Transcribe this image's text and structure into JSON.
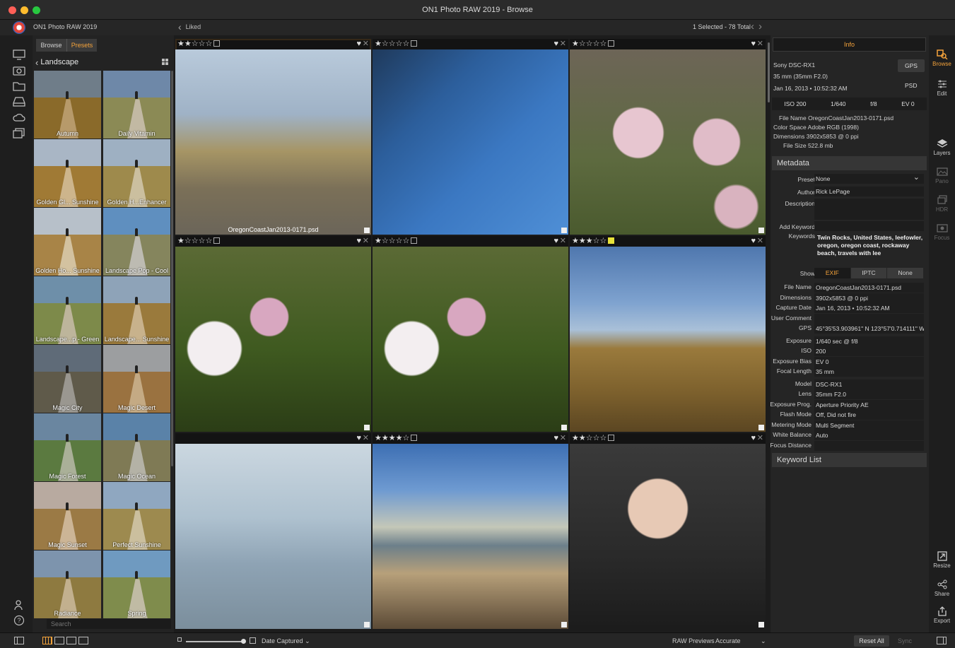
{
  "window": {
    "title": "ON1 Photo RAW 2019 - Browse"
  },
  "header": {
    "app_name": "ON1 Photo RAW 2019",
    "back_label": "Liked",
    "selection_status": "1 Selected - 78 Total"
  },
  "left_rail": {
    "icons": [
      "monitor-icon",
      "camera-icon",
      "folder-icon",
      "drive-icon",
      "cloud-icon",
      "albums-icon",
      "people-icon",
      "help-icon"
    ]
  },
  "preset_panel": {
    "tabs": [
      "Browse",
      "Presets"
    ],
    "active_tab": "Presets",
    "category": "Landscape",
    "search_placeholder": "Search",
    "presets": [
      {
        "label": "Autumn",
        "sky": "#6f7d89",
        "grass": "#8a6a2a",
        "path": "#b79a6a"
      },
      {
        "label": "Daily Vitamin",
        "sky": "#6e88a8",
        "grass": "#8b8a55",
        "path": "#c2b9a3"
      },
      {
        "label": "Golden Gl... Sunshine",
        "sky": "#a9b6c5",
        "grass": "#a07a35",
        "path": "#cdb58c"
      },
      {
        "label": "Golden H...Enhancer",
        "sky": "#9eb0c2",
        "grass": "#9e8a4c",
        "path": "#cbbf9f"
      },
      {
        "label": "Golden Ho... Sunshine",
        "sky": "#b7c0c9",
        "grass": "#a88447",
        "path": "#d3c2a0"
      },
      {
        "label": "Landscape Pop - Cool",
        "sky": "#5f8fbf",
        "grass": "#85855d",
        "path": "#bdbbb2"
      },
      {
        "label": "Landscape...p - Green",
        "sky": "#6e8fa9",
        "grass": "#7d8a4a",
        "path": "#bdb59b"
      },
      {
        "label": "Landscape... Sunshine",
        "sky": "#8ea3b8",
        "grass": "#9a7a3c",
        "path": "#c8b28c"
      },
      {
        "label": "Magic City",
        "sky": "#5f6b78",
        "grass": "#5f5a4a",
        "path": "#9a9790"
      },
      {
        "label": "Magic Desert",
        "sky": "#9c9ea0",
        "grass": "#9a7240",
        "path": "#c4aa84"
      },
      {
        "label": "Magic Forest",
        "sky": "#6a86a0",
        "grass": "#5b7a40",
        "path": "#aab098"
      },
      {
        "label": "Magic Ocean",
        "sky": "#5a82a8",
        "grass": "#7f7a55",
        "path": "#b4b2a6"
      },
      {
        "label": "Magic Sunset",
        "sky": "#b8aaa0",
        "grass": "#9b7a45",
        "path": "#ccb596"
      },
      {
        "label": "Perfect Sunshine",
        "sky": "#8fa7c0",
        "grass": "#9d8a4f",
        "path": "#cbbf9e"
      },
      {
        "label": "Radiance",
        "sky": "#7d94ad",
        "grass": "#8e7a40",
        "path": "#c2b08e"
      },
      {
        "label": "Spring",
        "sky": "#6f9ac0",
        "grass": "#7f8c4c",
        "path": "#c0bba4"
      }
    ]
  },
  "photos": [
    {
      "rating": 2,
      "flag": "none",
      "liked": true,
      "filename": "OregonCoastJan2013-0171.psd",
      "selected": true,
      "bg": "linear-gradient(180deg,#b9cadb 0%,#9fb2c6 35%,#a69565 55%,#7b7058 75%,#6b6559 100%)"
    },
    {
      "rating": 1,
      "flag": "none",
      "liked": true,
      "filename": "",
      "selected": false,
      "bg": "linear-gradient(135deg,#1f3a5c 0%,#2c5e9b 30%,#3b78c2 60%,#4f8fd6 100%)"
    },
    {
      "rating": 1,
      "flag": "none",
      "liked": true,
      "filename": "",
      "selected": false,
      "bg": "radial-gradient(circle at 35% 45%,#e7c6d0 0 15%,transparent 16%),radial-gradient(circle at 75% 50%,#e0bcc8 0 13%,transparent 14%),radial-gradient(circle at 85% 85%,#d9b3bf 0 9%,transparent 10%),linear-gradient(180deg,#6d6557 0%,#5d6a3f 60%,#4a5a2e 100%)"
    },
    {
      "rating": 1,
      "flag": "none",
      "liked": true,
      "filename": "",
      "selected": false,
      "bg": "radial-gradient(circle at 20% 55%,#f3eef0 0 14%,transparent 15%),radial-gradient(circle at 48% 38%,#d8a7c0 0 12%,transparent 13%),linear-gradient(180deg,#5b6a35 0%,#3f5a20 55%,#2b3d16 100%)"
    },
    {
      "rating": 1,
      "flag": "none",
      "liked": true,
      "filename": "",
      "selected": false,
      "bg": "radial-gradient(circle at 20% 55%,#f3eef0 0 14%,transparent 15%),radial-gradient(circle at 48% 38%,#d8a7c0 0 12%,transparent 13%),linear-gradient(180deg,#5b6a35 0%,#3f5a20 55%,#2b3d16 100%)"
    },
    {
      "rating": 3,
      "flag": "yellow",
      "liked": true,
      "filename": "",
      "selected": false,
      "bg": "linear-gradient(180deg,#4f77ae 0%,#7ea2cf 30%,#a9c0d8 45%,#9a7a3c 55%,#7b5f2c 80%,#5b4622 100%)"
    },
    {
      "rating": 0,
      "flag": "hidden",
      "liked": true,
      "filename": "",
      "selected": false,
      "bg": "linear-gradient(180deg,#cbd7e0 0%,#aec1cf 40%,#8ea3b4 65%,#7b8e9c 100%)"
    },
    {
      "rating": 4,
      "flag": "none",
      "liked": true,
      "filename": "",
      "selected": false,
      "bg": "linear-gradient(180deg,#3d6fb3 0%,#6e9ad1 25%,#c4c7b8 45%,#6c7f8a 55%,#b7a07a 70%,#5b4a36 100%)"
    },
    {
      "rating": 2,
      "flag": "none",
      "liked": true,
      "filename": "",
      "selected": false,
      "bg": "radial-gradient(circle at 45% 35%,#e7c9b5 0 18%,transparent 19%),linear-gradient(180deg,#3a3a3a 0%,#2a2a2a 60%,#1c1c1c 100%)"
    }
  ],
  "info_panel": {
    "tab_label": "Info",
    "camera": "Sony DSC-RX1",
    "lens_summary": "35 mm (35mm F2.0)",
    "datetime": "Jan 16, 2013 • 10:52:32 AM",
    "gps_button": "GPS",
    "file_type": "PSD",
    "exif_strip": [
      "ISO 200",
      "1/640",
      "f/8",
      "EV 0"
    ],
    "file_info": [
      "File Name OregonCoastJan2013-0171.psd",
      "Color Space Adobe RGB (1998)",
      "Dimensions 3902x5853 @ 0 ppi",
      "File Size 522.8 mb"
    ],
    "metadata_header": "Metadata",
    "fields": {
      "preset_label": "Preset",
      "preset_value": "None",
      "author_label": "Author",
      "author_value": "Rick LePage",
      "description_label": "Description",
      "add_keyword_label": "Add Keyword",
      "keywords_label": "Keywords",
      "keywords_value": "Twin Rocks, United States, leefowler, oregon, oregon coast, rockaway beach, travels with lee"
    },
    "show_label": "Show",
    "show_options": [
      "EXIF",
      "IPTC",
      "None"
    ],
    "exif_rows": [
      {
        "label": "File Name",
        "value": "OregonCoastJan2013-0171.psd"
      },
      {
        "label": "Dimensions",
        "value": "3902x5853 @ 0 ppi"
      },
      {
        "label": "Capture Date",
        "value": "Jan 16, 2013 • 10:52:32 AM"
      },
      {
        "label": "User Comment",
        "value": ""
      },
      {
        "label": "GPS",
        "value": "45°35'53.903961\" N 123°57'0.714111\" W"
      },
      {
        "label": "Exposure",
        "value": "1/640 sec @ f/8"
      },
      {
        "label": "ISO",
        "value": "200"
      },
      {
        "label": "Exposure Bias",
        "value": "EV 0"
      },
      {
        "label": "Focal Length",
        "value": "35 mm"
      },
      {
        "label": "Model",
        "value": "DSC-RX1"
      },
      {
        "label": "Lens",
        "value": "35mm F2.0"
      },
      {
        "label": "Exposure Prog.",
        "value": "Aperture Priority AE"
      },
      {
        "label": "Flash Mode",
        "value": "Off, Did not fire"
      },
      {
        "label": "Metering Mode",
        "value": "Multi Segment"
      },
      {
        "label": "White Balance",
        "value": "Auto"
      },
      {
        "label": "Focus Distance",
        "value": ""
      }
    ],
    "keyword_list_header": "Keyword List"
  },
  "modules": {
    "browse": "Browse",
    "edit": "Edit",
    "layers": "Layers",
    "pano": "Pano",
    "hdr": "HDR",
    "focus": "Focus",
    "resize": "Resize",
    "share": "Share",
    "export": "Export"
  },
  "bottom_bar": {
    "sort_label": "Date Captured",
    "raw_previews_label": "RAW Previews",
    "raw_previews_value": "Accurate",
    "reset_all": "Reset All",
    "sync": "Sync"
  },
  "colors": {
    "accent": "#f5a33b",
    "selection": "#f19a33",
    "background": "#1c1c1c"
  }
}
